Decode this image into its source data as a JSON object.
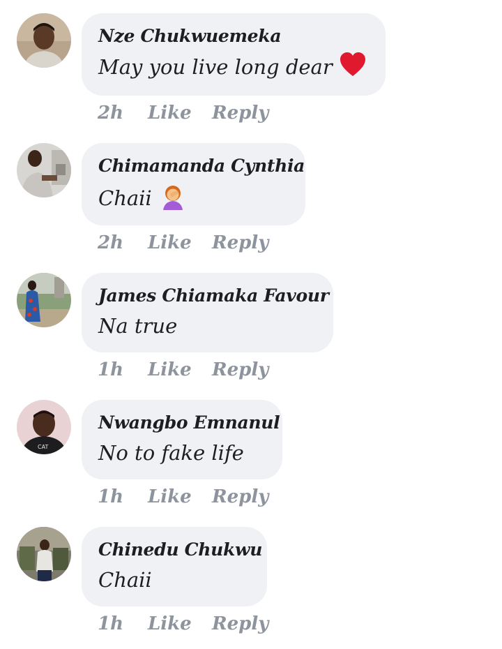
{
  "comments": [
    {
      "author": "Nze Chukwuemeka",
      "text": "May you live long dear",
      "emoji": "red-heart",
      "time": "2h",
      "like_label": "Like",
      "reply_label": "Reply"
    },
    {
      "author": "Chimamanda Cynthia",
      "text": "Chaii",
      "emoji": "facepalm",
      "time": "2h",
      "like_label": "Like",
      "reply_label": "Reply"
    },
    {
      "author": "James Chiamaka Favour",
      "text": "Na true",
      "time": "1h",
      "like_label": "Like",
      "reply_label": "Reply"
    },
    {
      "author": "Nwangbo Emnanul",
      "text": "No to fake life",
      "time": "1h",
      "like_label": "Like",
      "reply_label": "Reply"
    },
    {
      "author": "Chinedu Chukwu",
      "text": "Chaii",
      "time": "1h",
      "like_label": "Like",
      "reply_label": "Reply"
    }
  ],
  "colors": {
    "bubble": "#eff1f5",
    "text": "#1c1e21",
    "meta": "#8d949e",
    "heart": "#e0192f"
  }
}
